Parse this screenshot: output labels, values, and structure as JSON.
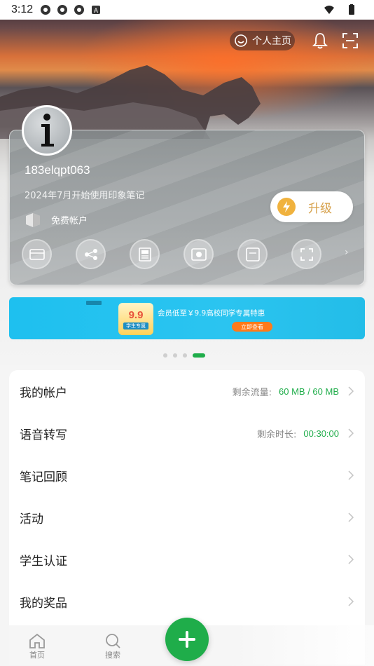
{
  "status_bar": {
    "time": "3:12"
  },
  "header": {
    "profile_home_label": "个人主页"
  },
  "profile": {
    "username": "183elqpt063",
    "since": "2024年7月开始使用印象笔记",
    "account_type": "免费帐户",
    "upgrade_label": "升级"
  },
  "banner": {
    "price": "9.9",
    "price_tag": "学生专属",
    "promo_text": "会员低至￥9.9高校同学专属特惠",
    "cta": "立即查看"
  },
  "carousel": {
    "count": 4,
    "active_index": 3
  },
  "menu": {
    "items": [
      {
        "label": "我的帐户",
        "key": "剩余流量:",
        "value": "60 MB / 60 MB"
      },
      {
        "label": "语音转写",
        "key": "剩余时长:",
        "value": "00:30:00"
      },
      {
        "label": "笔记回顾"
      },
      {
        "label": "活动"
      },
      {
        "label": "学生认证"
      },
      {
        "label": "我的奖品"
      }
    ]
  },
  "tabbar": {
    "home_label": "首页",
    "search_label": "搜索"
  },
  "colors": {
    "accent": "#1fad4a",
    "upgrade_text": "#d6a04a",
    "banner_bg": "#1ec0ef"
  }
}
